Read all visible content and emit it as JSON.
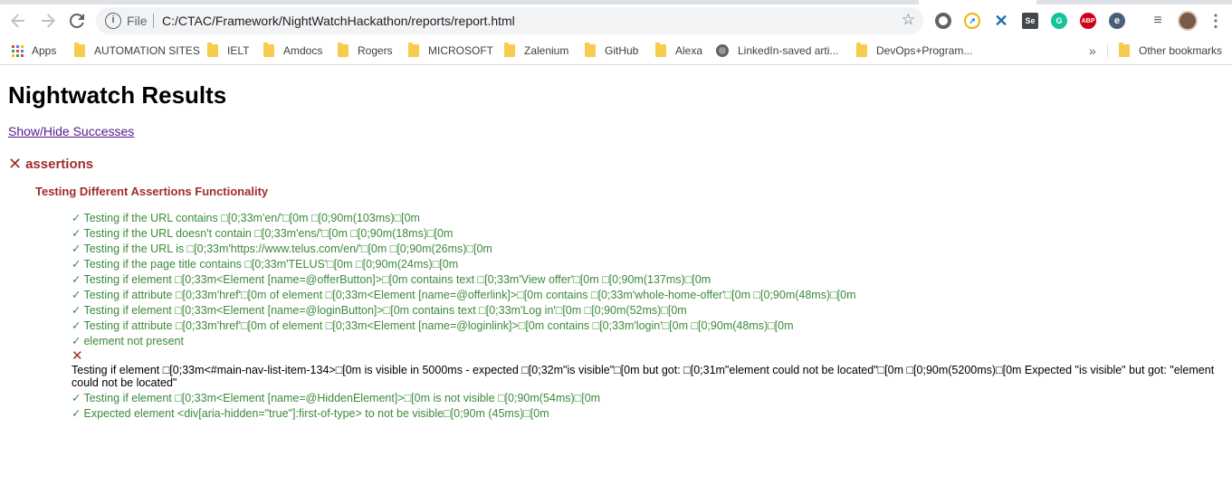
{
  "browser": {
    "protocol_label": "File",
    "url": "C:/CTAC/Framework/NightWatchHackathon/reports/report.html",
    "icons": {
      "back": "arrow-left-icon",
      "forward": "arrow-right-icon",
      "reload": "reload-icon",
      "info": "info-icon",
      "star": "star-icon",
      "menu": "kebab-menu-icon"
    },
    "bookmarks": {
      "apps": "Apps",
      "items": [
        "AUTOMATION SITES",
        "IELT",
        "Amdocs",
        "Rogers",
        "MICROSOFT",
        "Zalenium",
        "GitHub",
        "Alexa",
        "LinkedIn-saved arti...",
        "DevOps+Program..."
      ],
      "overflow": "»",
      "other": "Other bookmarks"
    },
    "extensions": {
      "abp": "ABP",
      "selenium": "Se",
      "grammarly": "G",
      "e": "e"
    }
  },
  "report": {
    "title": "Nightwatch Results",
    "toggle_label": "Show/Hide Successes",
    "module_name": "assertions",
    "suite_name": "Testing Different Assertions Functionality",
    "pass_mark": "✓",
    "fail_mark": "✕",
    "tests": [
      {
        "status": "pass",
        "text": "Testing if the URL contains □[0;33m'en/'□[0m □[0;90m(103ms)□[0m"
      },
      {
        "status": "pass",
        "text": "Testing if the URL doesn't contain □[0;33m'ens/'□[0m □[0;90m(18ms)□[0m"
      },
      {
        "status": "pass",
        "text": "Testing if the URL is □[0;33m'https://www.telus.com/en/'□[0m □[0;90m(26ms)□[0m"
      },
      {
        "status": "pass",
        "text": "Testing if the page title contains □[0;33m'TELUS'□[0m □[0;90m(24ms)□[0m"
      },
      {
        "status": "pass",
        "text": "Testing if element □[0;33m<Element [name=@offerButton]>□[0m contains text □[0;33m'View offer'□[0m □[0;90m(137ms)□[0m"
      },
      {
        "status": "pass",
        "text": "Testing if attribute □[0;33m'href'□[0m of element □[0;33m<Element [name=@offerlink]>□[0m contains □[0;33m'whole-home-offer'□[0m □[0;90m(48ms)□[0m"
      },
      {
        "status": "pass",
        "text": "Testing if element □[0;33m<Element [name=@loginButton]>□[0m contains text □[0;33m'Log in'□[0m □[0;90m(52ms)□[0m"
      },
      {
        "status": "pass",
        "text": "Testing if attribute □[0;33m'href'□[0m of element □[0;33m<Element [name=@loginlink]>□[0m contains □[0;33m'login'□[0m □[0;90m(48ms)□[0m"
      },
      {
        "status": "pass",
        "text": "element not present"
      },
      {
        "status": "fail",
        "text": "Testing if element □[0;33m<#main-nav-list-item-134>□[0m is visible in 5000ms - expected □[0;32m\"is visible\"□[0m but got: □[0;31m\"element could not be located\"□[0m □[0;90m(5200ms)□[0m Expected \"is visible\" but got: \"element could not be located\""
      },
      {
        "status": "pass",
        "text": "Testing if element □[0;33m<Element [name=@HiddenElement]>□[0m is not visible □[0;90m(54ms)□[0m"
      },
      {
        "status": "pass",
        "text": "Expected element <div[aria-hidden=\"true\"]:first-of-type> to not be visible□[0;90m (45ms)□[0m"
      }
    ]
  }
}
